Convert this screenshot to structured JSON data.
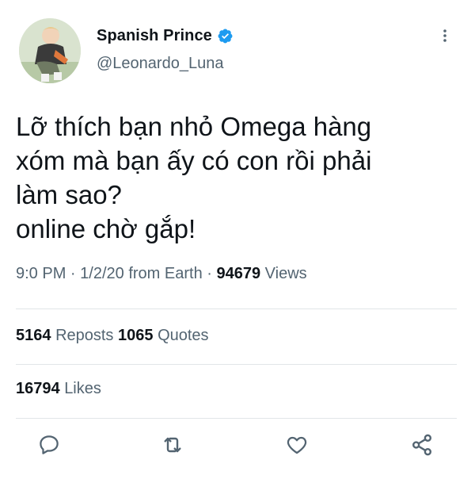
{
  "author": {
    "display_name": "Spanish Prince",
    "handle": "@Leonardo_Luna",
    "verified_icon": "verified-badge-icon",
    "avatar_icon": "profile-avatar"
  },
  "tweet": {
    "text": "Lỡ thích bạn nhỏ Omega hàng\nxóm mà bạn ấy có con rồi phải\nlàm sao?\nonline chờ gắp!",
    "time": "9:0 PM",
    "date": "1/2/20",
    "source": "from Earth",
    "separator": "·",
    "views_count": "94679",
    "views_label": "Views"
  },
  "stats": {
    "reposts_count": "5164",
    "reposts_label": "Reposts",
    "quotes_count": "1065",
    "quotes_label": "Quotes",
    "likes_count": "16794",
    "likes_label": "Likes"
  },
  "actions": [
    "reply-icon",
    "repost-icon",
    "like-icon",
    "share-icon"
  ],
  "colors": {
    "text": "#0f1419",
    "secondary": "#536471",
    "verified": "#1d9bf0",
    "divider": "#e1e5e8"
  }
}
